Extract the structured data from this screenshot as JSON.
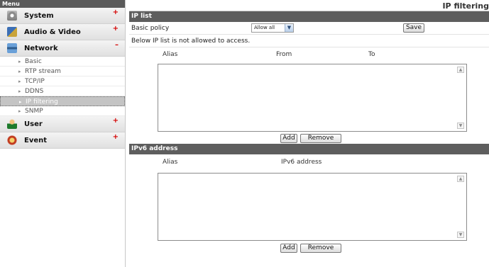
{
  "sidebar": {
    "title": "Menu",
    "items": [
      {
        "label": "System",
        "mark": "+"
      },
      {
        "label": "Audio & Video",
        "mark": "+"
      },
      {
        "label": "Network",
        "mark": "–"
      },
      {
        "label": "User",
        "mark": "+"
      },
      {
        "label": "Event",
        "mark": "+"
      }
    ],
    "network_sub": [
      "Basic",
      "RTP stream",
      "TCP/IP",
      "DDNS",
      "IP filtering",
      "SNMP"
    ],
    "active_sub": "IP filtering"
  },
  "page": {
    "title": "IP filtering"
  },
  "ip_list": {
    "header": "IP list",
    "basic_policy_label": "Basic policy",
    "basic_policy_value": "Allow all",
    "save_label": "Save",
    "note": "Below IP list is not allowed to access.",
    "columns": [
      "Alias",
      "From",
      "To"
    ],
    "rows": [],
    "add_label": "Add",
    "remove_label": "Remove"
  },
  "ipv6": {
    "header": "IPv6 address",
    "columns": [
      "Alias",
      "IPv6 address"
    ],
    "rows": [],
    "add_label": "Add",
    "remove_label": "Remove"
  },
  "icons": {
    "system": "gear-icon",
    "audio_video": "audio-video-icon",
    "network": "network-icon",
    "user": "user-icon",
    "event": "event-icon",
    "scroll_up": "scroll-up-arrow-icon",
    "scroll_down": "scroll-down-arrow-icon",
    "dropdown": "dropdown-arrow-icon"
  },
  "colors": {
    "section_header_bg": "#5e5e5e",
    "menu_header_bg": "#5a5a5a",
    "active_sub_bg": "#c4c4c4",
    "expand_mark": "#d40000"
  }
}
